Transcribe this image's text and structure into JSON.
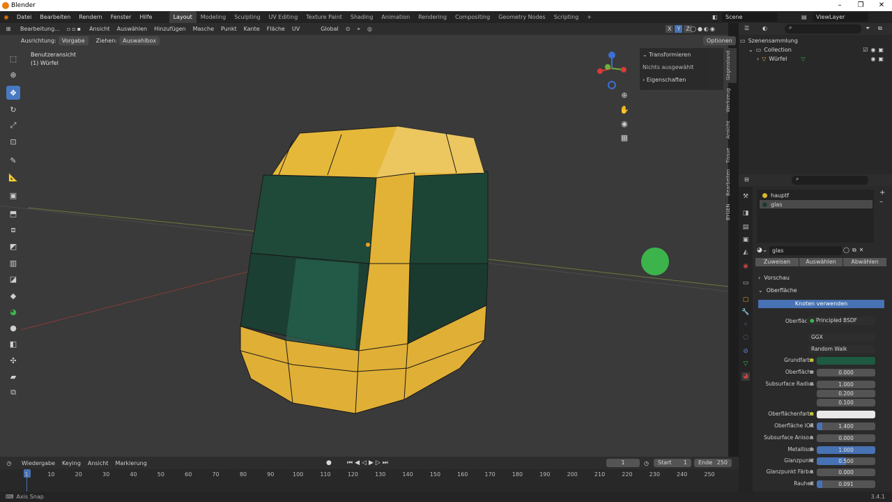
{
  "window": {
    "title": "Blender",
    "minimize": "–",
    "maximize": "❐",
    "close": "✕"
  },
  "menu": [
    "Datei",
    "Bearbeiten",
    "Rendern",
    "Fenster",
    "Hilfe"
  ],
  "workspaces": [
    "Layout",
    "Modeling",
    "Sculpting",
    "UV Editing",
    "Texture Paint",
    "Shading",
    "Animation",
    "Rendering",
    "Compositing",
    "Geometry Nodes",
    "Scripting",
    "+"
  ],
  "scene": "Scene",
  "view_layer": "ViewLayer",
  "viewport": {
    "mode": "Bearbeitung...",
    "menus": [
      "Ansicht",
      "Auswählen",
      "Hinzufügen",
      "Masche",
      "Punkt",
      "Kante",
      "Fläche",
      "UV"
    ],
    "transform": "Global",
    "options": "Optionen",
    "orientation_label": "Ausrichtung:",
    "orientation": "Vorgabe",
    "drag_label": "Ziehen:",
    "drag": "Auswahlbox",
    "view_name": "Benutzeransicht",
    "object_name": "(1) Würfel",
    "axes": [
      "X",
      "Y",
      "Z"
    ]
  },
  "npanel": {
    "transform": "Transformieren",
    "nothing_selected": "Nichts ausgewählt",
    "properties": "Eigenschaften"
  },
  "vtabs": [
    "Gegenstand",
    "Werkzeug",
    "Ansicht",
    "Tissue",
    "Bearbeiten",
    "BYGEN"
  ],
  "outliner": {
    "root": "Szenensammlung",
    "collection": "Collection",
    "object": "Würfel"
  },
  "material": {
    "slots": [
      "hauptf",
      "glas"
    ],
    "name": "glas",
    "buttons": [
      "Zuweisen",
      "Auswählen",
      "Abwählen"
    ],
    "preview": "Vorschau",
    "surface_section": "Oberfläche",
    "use_nodes": "Knoten verwenden",
    "surface_label": "Oberfläche",
    "surface_value": "Principled BSDF",
    "distribution": "GGX",
    "subsurface_method": "Random Walk",
    "props": [
      {
        "label": "Grundfarbe",
        "type": "color",
        "value": "#1e5a42"
      },
      {
        "label": "Oberfläche",
        "value": "0.000",
        "fill": 0
      },
      {
        "label": "Subsurface Radius",
        "value": "1.000",
        "fill": 0
      },
      {
        "label": "",
        "value": "0.200",
        "fill": 0
      },
      {
        "label": "",
        "value": "0.100",
        "fill": 0
      },
      {
        "label": "Oberflächenfarbe",
        "type": "color",
        "value": "#e8e8e8"
      },
      {
        "label": "Oberfläche IOR",
        "value": "1.400",
        "fill": 0.1
      },
      {
        "label": "Subsurface Aniso...",
        "value": "0.000",
        "fill": 0
      },
      {
        "label": "Metallisch",
        "value": "1.000",
        "fill": 1
      },
      {
        "label": "Glanzpunkt",
        "value": "0.500",
        "fill": 0.5
      },
      {
        "label": "Glanzpunkt Färb...",
        "value": "0.000",
        "fill": 0
      },
      {
        "label": "Rauheit",
        "value": "0.091",
        "fill": 0.091
      }
    ]
  },
  "timeline": {
    "menus": [
      "Wiedergabe",
      "Keying",
      "Ansicht",
      "Markierung"
    ],
    "current": "1",
    "start_label": "Start",
    "start": "1",
    "end_label": "Ende",
    "end": "250",
    "ticks": [
      "1",
      "10",
      "20",
      "30",
      "40",
      "50",
      "60",
      "70",
      "80",
      "90",
      "100",
      "110",
      "120",
      "130",
      "140",
      "150",
      "160",
      "170",
      "180",
      "190",
      "200",
      "210",
      "220",
      "230",
      "240",
      "250"
    ]
  },
  "status": {
    "left": "Axis Snap",
    "version": "3.4.1"
  }
}
